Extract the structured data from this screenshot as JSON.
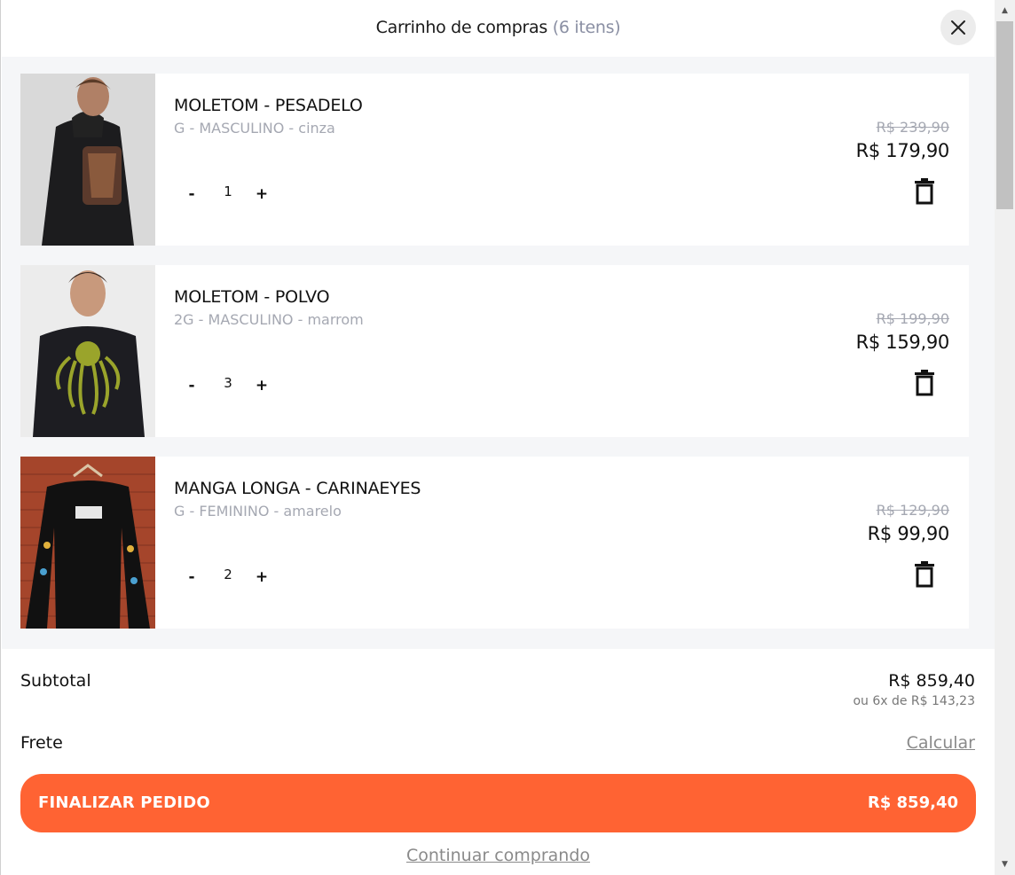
{
  "header": {
    "title": "Carrinho de compras",
    "count": "(6 itens)"
  },
  "items": [
    {
      "name": "MOLETOM - PESADELO",
      "variant": "G - MASCULINO - cinza",
      "qty": "1",
      "old_price": "R$ 239,90",
      "price": "R$ 179,90",
      "minus": "-",
      "plus": "+"
    },
    {
      "name": "MOLETOM - POLVO",
      "variant": "2G - MASCULINO - marrom",
      "qty": "3",
      "old_price": "R$ 199,90",
      "price": "R$ 159,90",
      "minus": "-",
      "plus": "+"
    },
    {
      "name": "MANGA LONGA - CARINAEYES",
      "variant": "G - FEMININO - amarelo",
      "qty": "2",
      "old_price": "R$ 129,90",
      "price": "R$ 99,90",
      "minus": "-",
      "plus": "+"
    }
  ],
  "summary": {
    "subtotal_label": "Subtotal",
    "subtotal_value": "R$ 859,40",
    "installments": "ou 6x de R$ 143,23",
    "frete_label": "Frete",
    "frete_link": "Calcular",
    "checkout_label": "FINALIZAR PEDIDO",
    "checkout_value": "R$ 859,40",
    "continue_label": "Continuar comprando"
  },
  "icons": {
    "close": "close-icon",
    "trash": "trash-icon"
  },
  "colors": {
    "accent": "#ff6333",
    "muted": "#a5a8b2",
    "list_bg": "#f5f6f8"
  }
}
